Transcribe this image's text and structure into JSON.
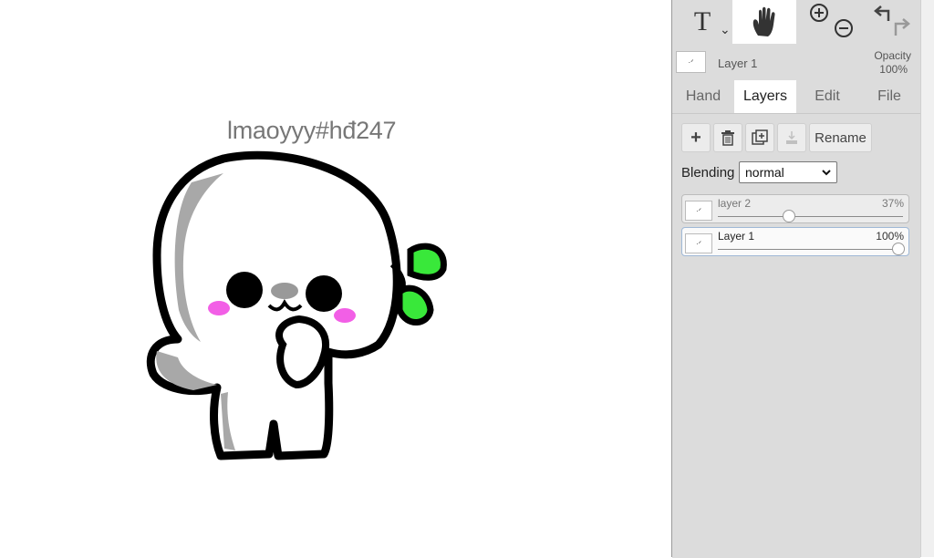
{
  "canvas": {
    "text": "lmaoyyy#hđ247"
  },
  "toolbar": {
    "text_tool_label": "T",
    "text_tool_caret": "⌄"
  },
  "current_layer": {
    "name": "Layer 1",
    "opacity_label": "Opacity",
    "opacity_value": "100%"
  },
  "tabs": [
    {
      "label": "Hand"
    },
    {
      "label": "Layers"
    },
    {
      "label": "Edit"
    },
    {
      "label": "File"
    }
  ],
  "layer_actions": {
    "rename_label": "Rename"
  },
  "blending": {
    "label": "Blending",
    "value": "normal"
  },
  "layers": [
    {
      "name": "layer 2",
      "opacity": "37%",
      "slider_fraction": 0.37
    },
    {
      "name": "Layer 1",
      "opacity": "100%",
      "slider_fraction": 1.0
    }
  ],
  "colors": {
    "accent_green": "#39e83a",
    "blush": "#f25fe6",
    "panel_bg": "#dcdcdc"
  }
}
